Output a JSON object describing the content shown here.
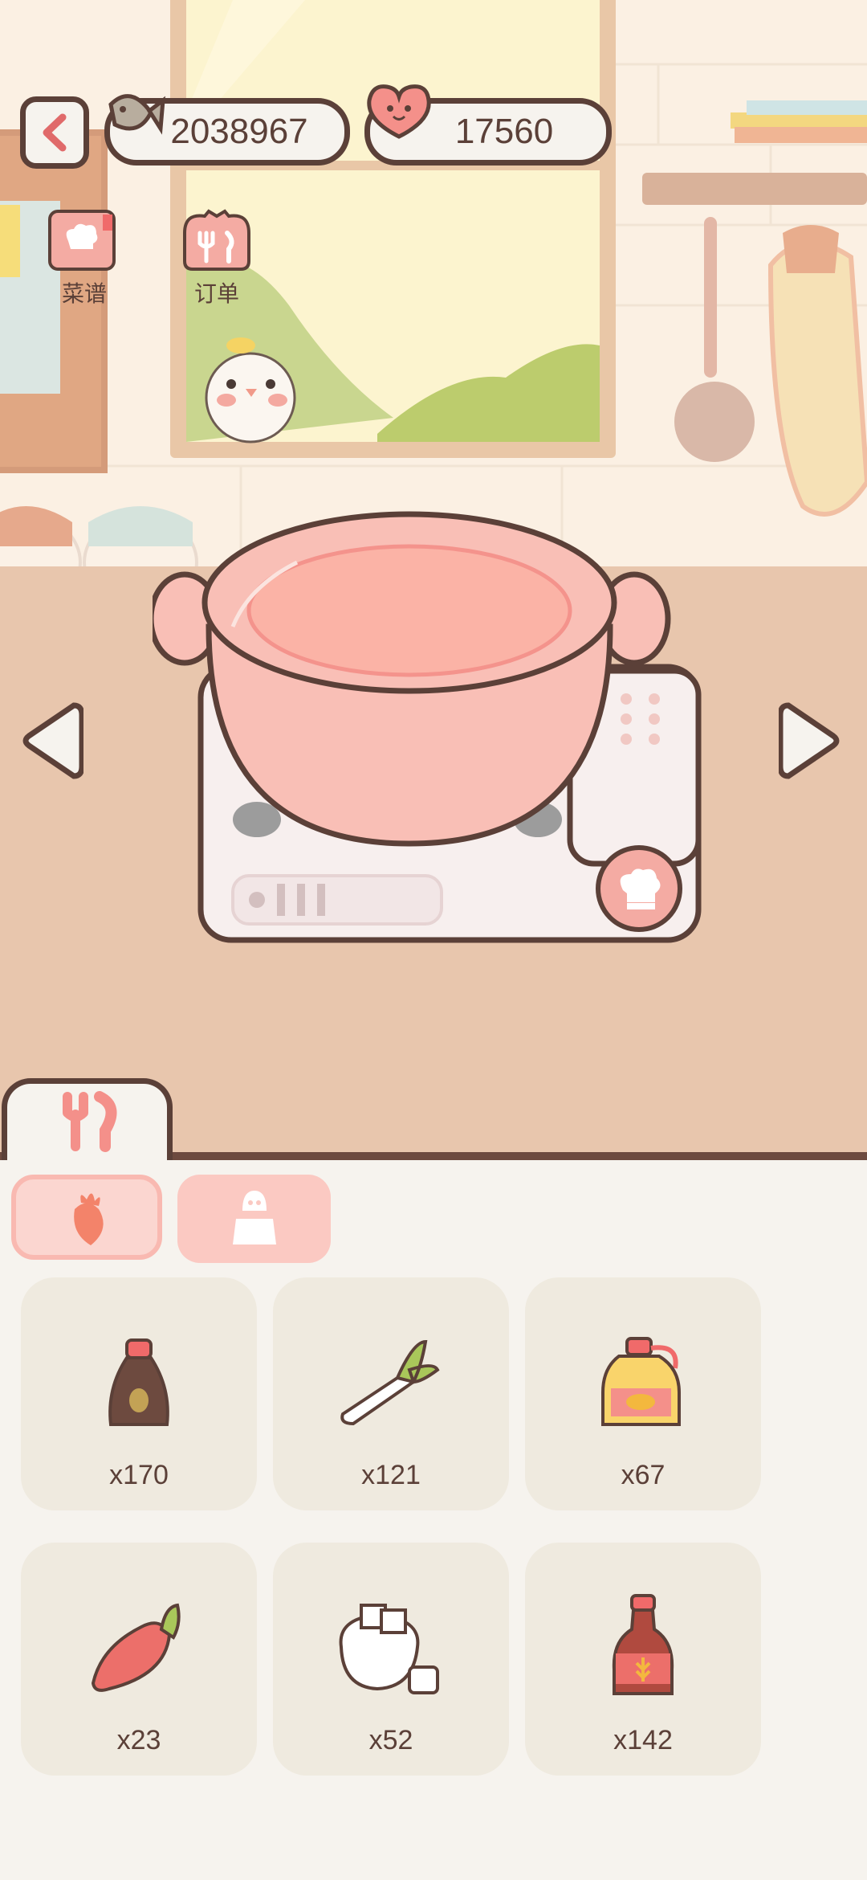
{
  "currencies": {
    "fish_coins": "2038967",
    "hearts": "17560"
  },
  "shortcuts": {
    "recipes_label": "菜谱",
    "orders_label": "订单"
  },
  "ingredients": [
    {
      "icon": "soy-sauce-bottle-icon",
      "count": "x170"
    },
    {
      "icon": "green-onion-icon",
      "count": "x121"
    },
    {
      "icon": "oil-jug-icon",
      "count": "x67"
    },
    {
      "icon": "chili-pepper-icon",
      "count": "x23"
    },
    {
      "icon": "sugar-bowl-icon",
      "count": "x52"
    },
    {
      "icon": "vinegar-bottle-icon",
      "count": "x142"
    }
  ],
  "colors": {
    "accent": "#f4aba3",
    "outline": "#5b4038",
    "pot": "#f9bfb6"
  }
}
